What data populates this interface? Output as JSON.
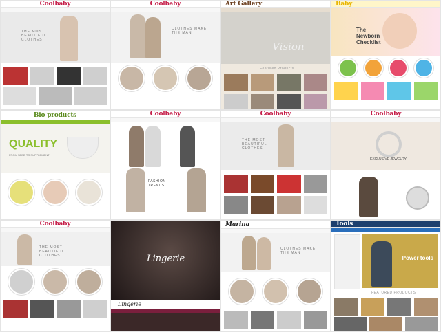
{
  "tiles": [
    {
      "brand": "Coolbaby",
      "accent": "#c51c47",
      "tagline": "THE MOST BEAUTIFUL CLOTHES"
    },
    {
      "brand": "Coolbaby",
      "accent": "#c51c47",
      "tagline": "CLOTHES MAKE THE MAN"
    },
    {
      "brand": "Art Gallery",
      "accent": "#6b3f1f",
      "tagline": "Vision",
      "sub": "Featured Products"
    },
    {
      "brand": "Baby",
      "accent": "#e8b400",
      "tagline": "The Newborn Checklist"
    },
    {
      "brand": "Bio products",
      "accent": "#8bbf2c",
      "tagline": "QUALITY",
      "sub": "FROM SEED TO SUPPLEMENT"
    },
    {
      "brand": "Coolbaby",
      "accent": "#c51c47",
      "tagline": "FASHION TRENDS"
    },
    {
      "brand": "Coolbaby",
      "accent": "#c51c47",
      "tagline": "THE MOST BEAUTIFUL CLOTHES"
    },
    {
      "brand": "Coolbaby",
      "accent": "#c51c47",
      "tagline": "EXCLUSIVE JEWELRY"
    },
    {
      "brand": "Coolbaby",
      "accent": "#c51c47",
      "tagline": "THE MOST BEAUTIFUL CLOTHES"
    },
    {
      "brand": "Lingerie",
      "accent": "#7a1f3d",
      "tagline": "Lingerie"
    },
    {
      "brand": "Marina",
      "accent": "#c51c47",
      "tagline": "CLOTHES MAKE THE MAN"
    },
    {
      "brand": "Tools",
      "accent": "#2a6ebb",
      "tagline": "Power tools",
      "sub": "FEATURED PRODUCTS"
    }
  ]
}
